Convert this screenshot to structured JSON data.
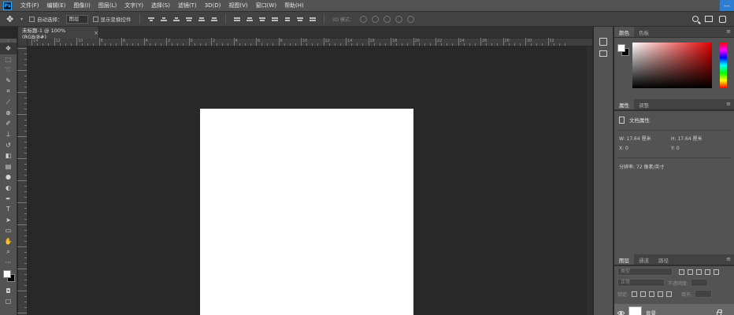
{
  "app": {
    "logo_text": "Ps"
  },
  "menu": [
    "文件(F)",
    "编辑(E)",
    "图像(I)",
    "图层(L)",
    "文字(Y)",
    "选择(S)",
    "滤镜(T)",
    "3D(D)",
    "视图(V)",
    "窗口(W)",
    "帮助(H)"
  ],
  "window_controls": {
    "minimize": "—",
    "maximize": "□",
    "close": "✕"
  },
  "options": {
    "auto_select_label": "自动选择：",
    "auto_select_value": "图层",
    "transform_label": "显示变换控件",
    "mode_3d_label": "3D 模式："
  },
  "document": {
    "tab_title": "未标题-1 @ 100%(RGB/8#)",
    "tab_close": "×"
  },
  "ruler": {
    "h_labels": [
      "14",
      "12",
      "10",
      "8",
      "6",
      "4",
      "2",
      "0",
      "2",
      "4",
      "6",
      "8",
      "10",
      "12",
      "14",
      "16",
      "18",
      "20",
      "22",
      "24",
      "26",
      "28",
      "30",
      "32"
    ]
  },
  "panels": {
    "color_tabs": [
      "颜色",
      "色板"
    ],
    "props_tabs": [
      "属性",
      "调整"
    ],
    "props_title": "文档属性",
    "width_label": "W:  17.64 厘米",
    "height_label": "H:  17.64 厘米",
    "x_label": "X:  0",
    "y_label": "Y:  0",
    "resolution_label": "分辨率: 72 像素/英寸",
    "layer_tabs": [
      "图层",
      "通道",
      "路径"
    ],
    "filter_label": "类型",
    "blend_mode": "正常",
    "opacity_label": "不透明度:",
    "lock_label": "锁定:",
    "fill_label": "填充:",
    "layer_name": "背景",
    "menu_icon": "≡"
  },
  "colors": {
    "foreground": "#ffffff",
    "background": "#000000",
    "accent": "#2d7dd2",
    "canvas": "#ffffff"
  }
}
